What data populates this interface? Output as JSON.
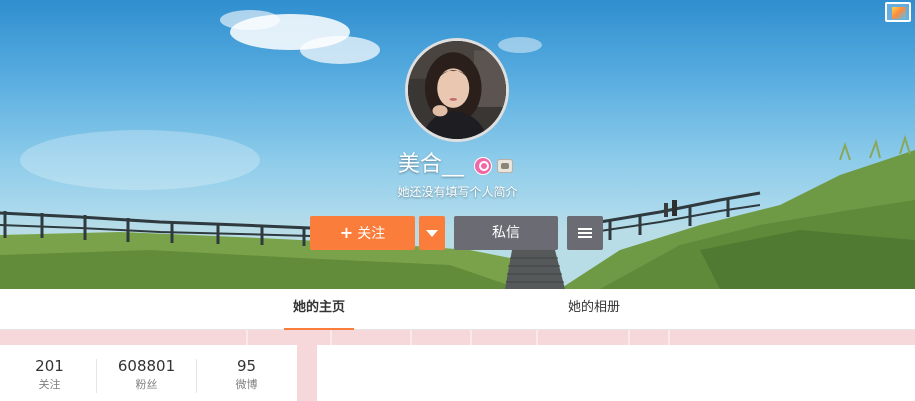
{
  "profile": {
    "name": "美合__",
    "bio": "她还没有填写个人简介"
  },
  "actions": {
    "follow_label": "关注",
    "follow_plus": "+",
    "message_label": "私信"
  },
  "tabs": [
    {
      "label": "她的主页",
      "active": true
    },
    {
      "label": "她的相册",
      "active": false
    }
  ],
  "stats": [
    {
      "value": "201",
      "label": "关注"
    },
    {
      "value": "608801",
      "label": "粉丝"
    },
    {
      "value": "95",
      "label": "微博"
    }
  ],
  "icons": {
    "cover_edit": "image-icon",
    "vip": "vip-badge-icon",
    "level": "member-level-icon",
    "follow_menu": "chevron-down-icon",
    "more": "menu-icon"
  },
  "colors": {
    "accent": "#fa7d3c",
    "secondary_button": "#6b6b73",
    "page_background": "#f6d7da"
  }
}
